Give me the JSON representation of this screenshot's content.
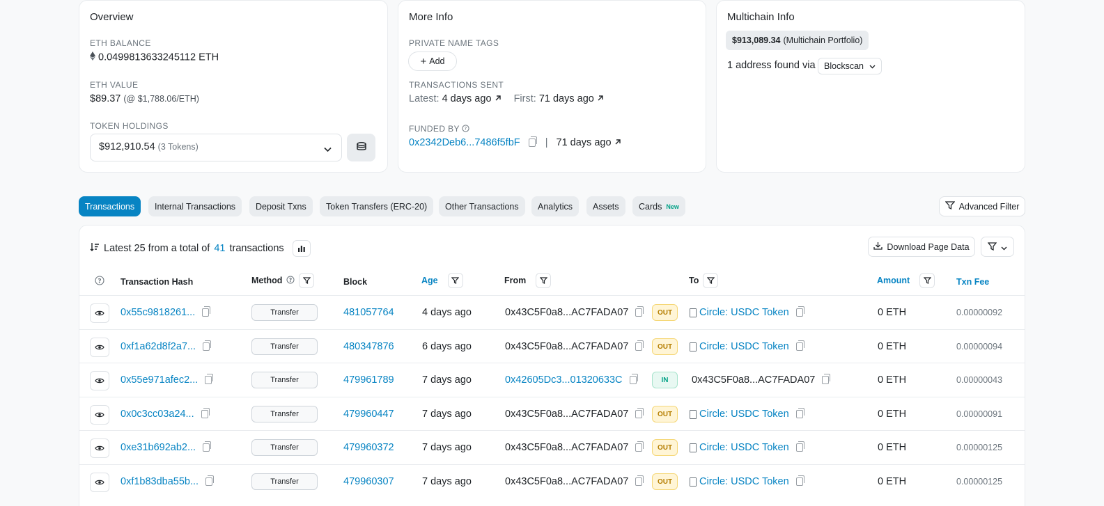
{
  "overview": {
    "title": "Overview",
    "eth_balance_label": "ETH BALANCE",
    "eth_balance": "0.0499813633245112 ETH",
    "eth_value_label": "ETH VALUE",
    "eth_value": "$89.37",
    "eth_price": "(@ $1,788.06/ETH)",
    "token_holdings_label": "TOKEN HOLDINGS",
    "token_holdings_value": "$912,910.54",
    "token_holdings_count": "(3 Tokens)"
  },
  "more_info": {
    "title": "More Info",
    "private_tags_label": "PRIVATE NAME TAGS",
    "add_label": "Add",
    "tx_sent_label": "TRANSACTIONS SENT",
    "latest_label": "Latest:",
    "latest_value": "4 days ago",
    "first_label": "First:",
    "first_value": "71 days ago",
    "funded_by_label": "FUNDED BY",
    "funded_by_address": "0x2342Deb6...7486f5fbF",
    "funded_by_age": "71 days ago"
  },
  "multichain": {
    "title": "Multichain Info",
    "portfolio_value": "$913,089.34",
    "portfolio_label": "(Multichain Portfolio)",
    "found_text": "1 address found via",
    "source": "Blockscan"
  },
  "tabs": [
    {
      "label": "Transactions"
    },
    {
      "label": "Internal Transactions"
    },
    {
      "label": "Deposit Txns"
    },
    {
      "label": "Token Transfers (ERC-20)"
    },
    {
      "label": "Other Transactions"
    },
    {
      "label": "Analytics"
    },
    {
      "label": "Assets"
    },
    {
      "label": "Cards",
      "badge": "New"
    }
  ],
  "advanced_filter_label": "Advanced Filter",
  "summary": {
    "prefix": "Latest 25 from a total of",
    "total": "41",
    "suffix": "transactions"
  },
  "download_label": "Download Page Data",
  "columns": {
    "hash": "Transaction Hash",
    "method": "Method",
    "block": "Block",
    "age": "Age",
    "from": "From",
    "to": "To",
    "amount": "Amount",
    "fee": "Txn Fee"
  },
  "rows": [
    {
      "hash": "0x55c9818261...",
      "method": "Transfer",
      "block": "481057764",
      "age": "4 days ago",
      "from": "0x43C5F0a8...AC7FADA07",
      "from_link": false,
      "dir": "OUT",
      "to": "Circle: USDC Token",
      "to_contract": true,
      "amount": "0 ETH",
      "fee": "0.00000092"
    },
    {
      "hash": "0xf1a62d8f2a7...",
      "method": "Transfer",
      "block": "480347876",
      "age": "6 days ago",
      "from": "0x43C5F0a8...AC7FADA07",
      "from_link": false,
      "dir": "OUT",
      "to": "Circle: USDC Token",
      "to_contract": true,
      "amount": "0 ETH",
      "fee": "0.00000094"
    },
    {
      "hash": "0x55e971afec2...",
      "method": "Transfer",
      "block": "479961789",
      "age": "7 days ago",
      "from": "0x42605Dc3...01320633C",
      "from_link": true,
      "dir": "IN",
      "to": "0x43C5F0a8...AC7FADA07",
      "to_contract": false,
      "amount": "0 ETH",
      "fee": "0.00000043"
    },
    {
      "hash": "0x0c3cc03a24...",
      "method": "Transfer",
      "block": "479960447",
      "age": "7 days ago",
      "from": "0x43C5F0a8...AC7FADA07",
      "from_link": false,
      "dir": "OUT",
      "to": "Circle: USDC Token",
      "to_contract": true,
      "amount": "0 ETH",
      "fee": "0.00000091"
    },
    {
      "hash": "0xe31b692ab2...",
      "method": "Transfer",
      "block": "479960372",
      "age": "7 days ago",
      "from": "0x43C5F0a8...AC7FADA07",
      "from_link": false,
      "dir": "OUT",
      "to": "Circle: USDC Token",
      "to_contract": true,
      "amount": "0 ETH",
      "fee": "0.00000125"
    },
    {
      "hash": "0xf1b83dba55b...",
      "method": "Transfer",
      "block": "479960307",
      "age": "7 days ago",
      "from": "0x43C5F0a8...AC7FADA07",
      "from_link": false,
      "dir": "OUT",
      "to": "Circle: USDC Token",
      "to_contract": true,
      "amount": "0 ETH",
      "fee": "0.00000125"
    }
  ]
}
